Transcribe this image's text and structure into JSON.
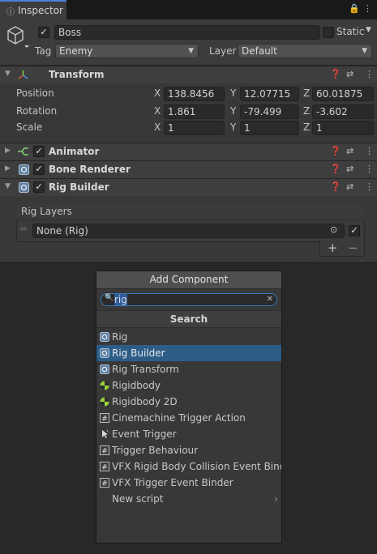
{
  "tab": {
    "title": "Inspector",
    "lock_icon": "lock-icon",
    "menu_icon": "kebab-menu-icon"
  },
  "header": {
    "active": true,
    "name": "Boss",
    "static_label": "Static",
    "static_checked": false,
    "tag_label": "Tag",
    "tag_value": "Enemy",
    "layer_label": "Layer",
    "layer_value": "Default"
  },
  "transform": {
    "title": "Transform",
    "rows": [
      {
        "label": "Position",
        "x": "138.8456",
        "y": "12.07715",
        "z": "60.01875"
      },
      {
        "label": "Rotation",
        "x": "1.861",
        "y": "-79.499",
        "z": "-3.602"
      },
      {
        "label": "Scale",
        "x": "1",
        "y": "1",
        "z": "1"
      }
    ],
    "axis": {
      "x": "X",
      "y": "Y",
      "z": "Z"
    }
  },
  "components": [
    {
      "title": "Animator",
      "enabled": true
    },
    {
      "title": "Bone Renderer",
      "enabled": true
    },
    {
      "title": "Rig Builder",
      "enabled": true
    }
  ],
  "rig_builder": {
    "layers_title": "Rig Layers",
    "layer_value": "None (Rig)",
    "layer_active": true,
    "plus": "+",
    "minus": "−"
  },
  "add_component": {
    "title": "Add Component",
    "search_value": "rig",
    "section": "Search",
    "selected_index": 1,
    "items": [
      {
        "label": "Rig",
        "icon": "script-component-icon"
      },
      {
        "label": "Rig Builder",
        "icon": "script-component-icon"
      },
      {
        "label": "Rig Transform",
        "icon": "script-component-icon"
      },
      {
        "label": "Rigidbody",
        "icon": "rigidbody-icon"
      },
      {
        "label": "Rigidbody 2D",
        "icon": "rigidbody-icon"
      },
      {
        "label": "Cinemachine Trigger Action",
        "icon": "csharp-script-icon"
      },
      {
        "label": "Event Trigger",
        "icon": "event-trigger-icon"
      },
      {
        "label": "Trigger Behaviour",
        "icon": "csharp-script-icon"
      },
      {
        "label": "VFX Rigid Body Collision Event Binder",
        "icon": "csharp-script-icon"
      },
      {
        "label": "VFX Trigger Event Binder",
        "icon": "csharp-script-icon"
      },
      {
        "label": "New script",
        "icon": ""
      }
    ]
  }
}
